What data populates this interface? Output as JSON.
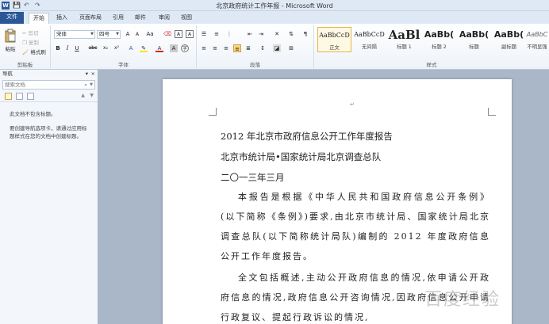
{
  "window": {
    "title": "北京政府统计工作年报 - Microsoft Word",
    "app_icon": "W",
    "qa_save": "💾",
    "qa_undo": "↶",
    "qa_redo": "↷"
  },
  "tabs": [
    "文件",
    "开始",
    "插入",
    "页面布局",
    "引用",
    "邮件",
    "审阅",
    "视图"
  ],
  "ribbon": {
    "clipboard": {
      "paste": "粘贴",
      "cut": "剪切",
      "copy": "复制",
      "format_painter": "格式刷",
      "label": "剪贴板"
    },
    "font": {
      "name": "宋体",
      "size": "四号",
      "grow": "A",
      "shrink": "A",
      "aa": "Aa",
      "bold": "B",
      "italic": "I",
      "underline": "U",
      "strike": "abc",
      "sub": "x₂",
      "sup": "x²",
      "color_a": "A",
      "label": "字体"
    },
    "paragraph": {
      "label": "段落"
    },
    "styles": {
      "label": "样式",
      "items": [
        {
          "sample": "AaBbCcD",
          "name": "正文"
        },
        {
          "sample": "AaBbCcD",
          "name": "无间隔"
        },
        {
          "sample": "AaBl",
          "name": "标题 1"
        },
        {
          "sample": "AaBb(",
          "name": "标题 2"
        },
        {
          "sample": "AaBb(",
          "name": "标题"
        },
        {
          "sample": "AaBb(",
          "name": "副标题"
        },
        {
          "sample": "AaBbC",
          "name": "不明显强"
        }
      ]
    }
  },
  "nav": {
    "title": "导航",
    "search_placeholder": "搜索文档",
    "message1": "此文档不包含标题。",
    "message2": "要创建导航选项卡，请通过应用标题样式在您的文档中创建标题。"
  },
  "document": {
    "line1": "2012 年北京市政府信息公开工作年度报告",
    "line2": "北京市统计局•国家统计局北京调查总队",
    "line3": "二〇一三年三月",
    "para1": "本报告是根据《中华人民共和国政府信息公开条例》(以下简称《条例》)要求,由北京市统计局、国家统计局北京调查总队(以下简称统计局队)编制的 2012 年度政府信息公开工作年度报告。",
    "para2": "全文包括概述,主动公开政府信息的情况,依申请公开政府信息的情况,政府信息公开咨询情况,因政府信息公开申请行政复议、提起行政诉讼的情况,",
    "watermark": "百度经验"
  }
}
